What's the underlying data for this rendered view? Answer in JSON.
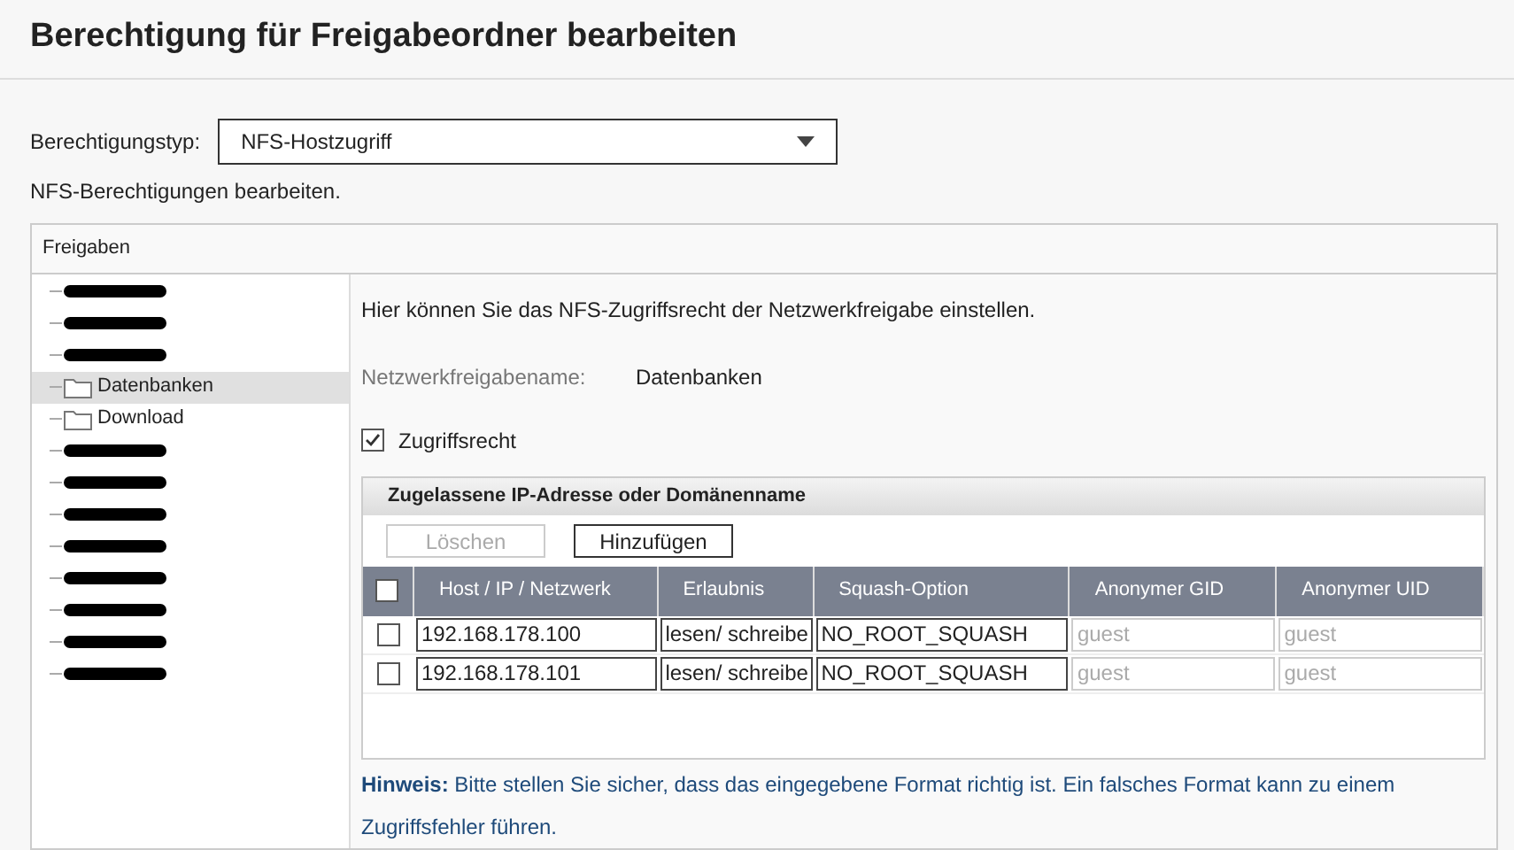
{
  "title": "Berechtigung für Freigabeordner bearbeiten",
  "permission_type": {
    "label": "Berechtigungstyp:",
    "value": "NFS-Hostzugriff"
  },
  "subtitle": "NFS-Berechtigungen bearbeiten.",
  "panel": {
    "title": "Freigaben",
    "tree": [
      {
        "kind": "redacted",
        "selected": false
      },
      {
        "kind": "redacted",
        "selected": false
      },
      {
        "kind": "redacted",
        "selected": false
      },
      {
        "kind": "folder",
        "label": "Datenbanken",
        "selected": true
      },
      {
        "kind": "folder",
        "label": "Download",
        "selected": false
      },
      {
        "kind": "redacted",
        "selected": false
      },
      {
        "kind": "redacted",
        "selected": false
      },
      {
        "kind": "redacted",
        "selected": false
      },
      {
        "kind": "redacted",
        "selected": false
      },
      {
        "kind": "redacted",
        "selected": false
      },
      {
        "kind": "redacted",
        "selected": false
      },
      {
        "kind": "redacted",
        "selected": false
      },
      {
        "kind": "redacted",
        "selected": false
      }
    ],
    "intro": "Hier können Sie das NFS-Zugriffsrecht der Netzwerkfreigabe einstellen.",
    "share_name": {
      "label": "Netzwerkfreigabename:",
      "value": "Datenbanken"
    },
    "access": {
      "label": "Zugriffsrecht",
      "checked": true
    },
    "hosts": {
      "title": "Zugelassene IP-Adresse oder Domänenname",
      "buttons": [
        {
          "label": "Löschen",
          "disabled": true
        },
        {
          "label": "Hinzufügen",
          "disabled": false
        }
      ],
      "select_all": false,
      "columns": [
        "Host / IP / Netzwerk",
        "Erlaubnis",
        "Squash-Option",
        "Anonymer GID",
        "Anonymer UID"
      ],
      "rows": [
        {
          "checked": false,
          "host": "192.168.178.100",
          "permission": "lesen/ schreibe",
          "squash": "NO_ROOT_SQUASH",
          "gid_placeholder": "guest",
          "uid_placeholder": "guest"
        },
        {
          "checked": false,
          "host": "192.168.178.101",
          "permission": "lesen/ schreibe",
          "squash": "NO_ROOT_SQUASH",
          "gid_placeholder": "guest",
          "uid_placeholder": "guest"
        }
      ]
    },
    "note": "**Hinweis:** Bitte stellen Sie sicher, dass das eingegebene Format richtig ist. Ein falsches Format kann zu einem Zugriffsfehler führen."
  }
}
